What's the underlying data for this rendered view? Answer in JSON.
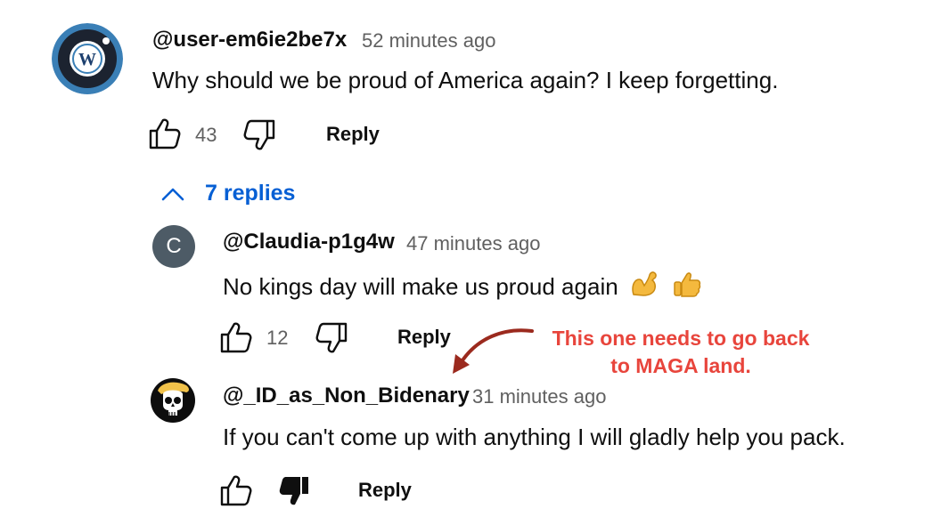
{
  "comment": {
    "handle": "@user-em6ie2be7x",
    "time": "52 minutes ago",
    "text": "Why should we be proud of America again? I keep forgetting.",
    "likes": "43",
    "reply_label": "Reply"
  },
  "replies_toggle": {
    "label": "7 replies"
  },
  "replies": [
    {
      "avatar_letter": "C",
      "avatar_color": "#4d5b66",
      "handle": "@Claudia-p1g4w",
      "time": "47 minutes ago",
      "text": "No kings day will make us proud again",
      "emojis": [
        "flexed-biceps-icon",
        "thumbs-up-icon"
      ],
      "likes": "12",
      "reply_label": "Reply"
    },
    {
      "handle": "@_ID_as_Non_Bidenary",
      "time": "31 minutes ago",
      "text": "If you can't come up with anything I will gladly help you pack.",
      "dislike_active": true,
      "reply_label": "Reply"
    }
  ],
  "annotation": {
    "line1": "This one needs to go back",
    "line2": "to MAGA land.",
    "color": "#e8453c"
  },
  "colors": {
    "link": "#065fd4",
    "muted": "#606060",
    "text": "#0f0f0f"
  }
}
